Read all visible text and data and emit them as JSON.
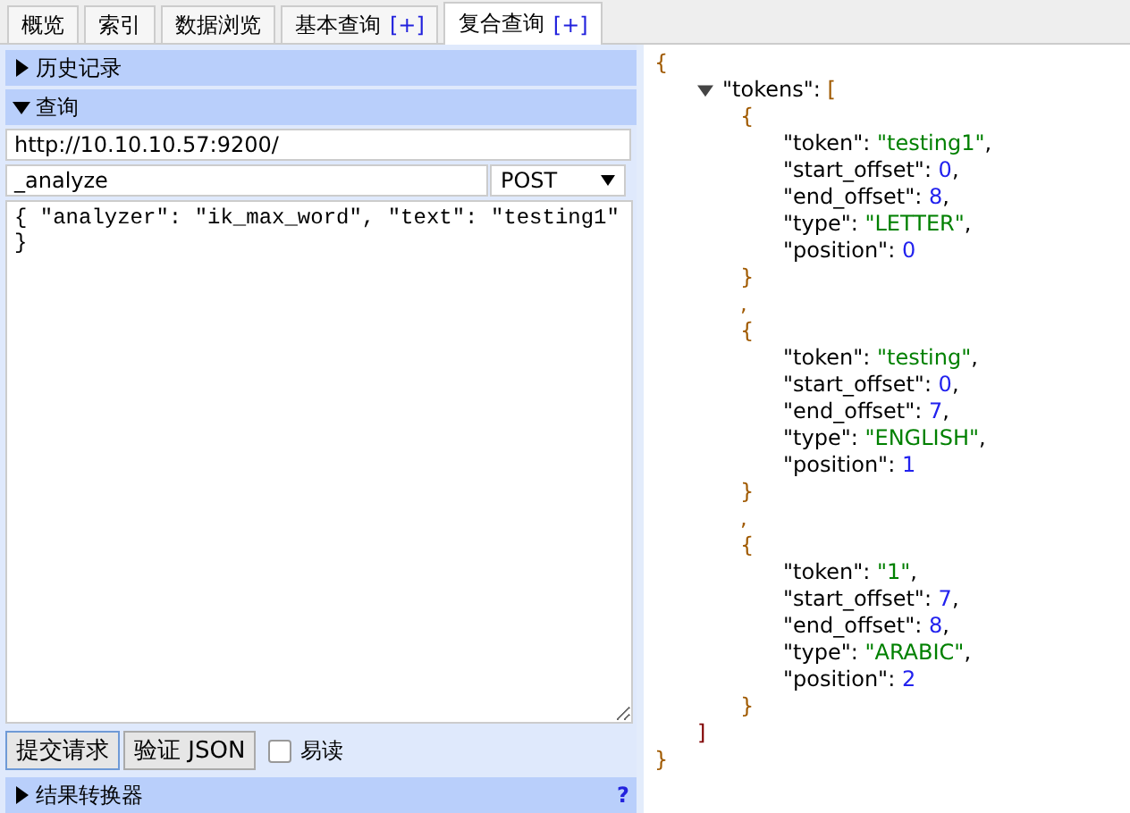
{
  "tabs": [
    {
      "label": "概览",
      "selected": false
    },
    {
      "label": "索引",
      "selected": false
    },
    {
      "label": "数据浏览",
      "selected": false
    },
    {
      "label": "基本查询",
      "extra": "[+]",
      "selected": false
    },
    {
      "label": "复合查询",
      "extra": "[+]",
      "selected": true
    }
  ],
  "sections": [
    {
      "label": "历史记录",
      "expanded": false
    },
    {
      "label": "查询",
      "expanded": true
    }
  ],
  "query": {
    "url": "http://10.10.10.57:9200/",
    "path": "_analyze",
    "method": "POST",
    "body": "{ \"analyzer\": \"ik_max_word\", \"text\": \"testing1\"\n}"
  },
  "actions": {
    "submit": "提交请求",
    "validate": "验证 JSON",
    "pretty": {
      "label": "易读",
      "checked": false
    }
  },
  "bottom_section": {
    "label": "结果转换器",
    "expanded": false,
    "help": "?"
  },
  "result": {
    "open": "{",
    "key": "\"tokens\"",
    "colon": ": ",
    "array_open": "[",
    "expanded": true,
    "separator": ",",
    "array_close": "]",
    "close": "}",
    "items": [
      {
        "open": "{",
        "close": "}",
        "fields": [
          {
            "key": "\"token\"",
            "colon": ": ",
            "value": "\"testing1\"",
            "kind": "string",
            "comma": ","
          },
          {
            "key": "\"start_offset\"",
            "colon": ": ",
            "value": "0",
            "kind": "number",
            "comma": ","
          },
          {
            "key": "\"end_offset\"",
            "colon": ": ",
            "value": "8",
            "kind": "number",
            "comma": ","
          },
          {
            "key": "\"type\"",
            "colon": ": ",
            "value": "\"LETTER\"",
            "kind": "string",
            "comma": ","
          },
          {
            "key": "\"position\"",
            "colon": ": ",
            "value": "0",
            "kind": "number"
          }
        ]
      },
      {
        "open": "{",
        "close": "}",
        "fields": [
          {
            "key": "\"token\"",
            "colon": ": ",
            "value": "\"testing\"",
            "kind": "string",
            "comma": ","
          },
          {
            "key": "\"start_offset\"",
            "colon": ": ",
            "value": "0",
            "kind": "number",
            "comma": ","
          },
          {
            "key": "\"end_offset\"",
            "colon": ": ",
            "value": "7",
            "kind": "number",
            "comma": ","
          },
          {
            "key": "\"type\"",
            "colon": ": ",
            "value": "\"ENGLISH\"",
            "kind": "string",
            "comma": ","
          },
          {
            "key": "\"position\"",
            "colon": ": ",
            "value": "1",
            "kind": "number"
          }
        ]
      },
      {
        "open": "{",
        "close": "}",
        "fields": [
          {
            "key": "\"token\"",
            "colon": ": ",
            "value": "\"1\"",
            "kind": "string",
            "comma": ","
          },
          {
            "key": "\"start_offset\"",
            "colon": ": ",
            "value": "7",
            "kind": "number",
            "comma": ","
          },
          {
            "key": "\"end_offset\"",
            "colon": ": ",
            "value": "8",
            "kind": "number",
            "comma": ","
          },
          {
            "key": "\"type\"",
            "colon": ": ",
            "value": "\"ARABIC\"",
            "kind": "string",
            "comma": ","
          },
          {
            "key": "\"position\"",
            "colon": ": ",
            "value": "2",
            "kind": "number"
          }
        ]
      }
    ]
  }
}
